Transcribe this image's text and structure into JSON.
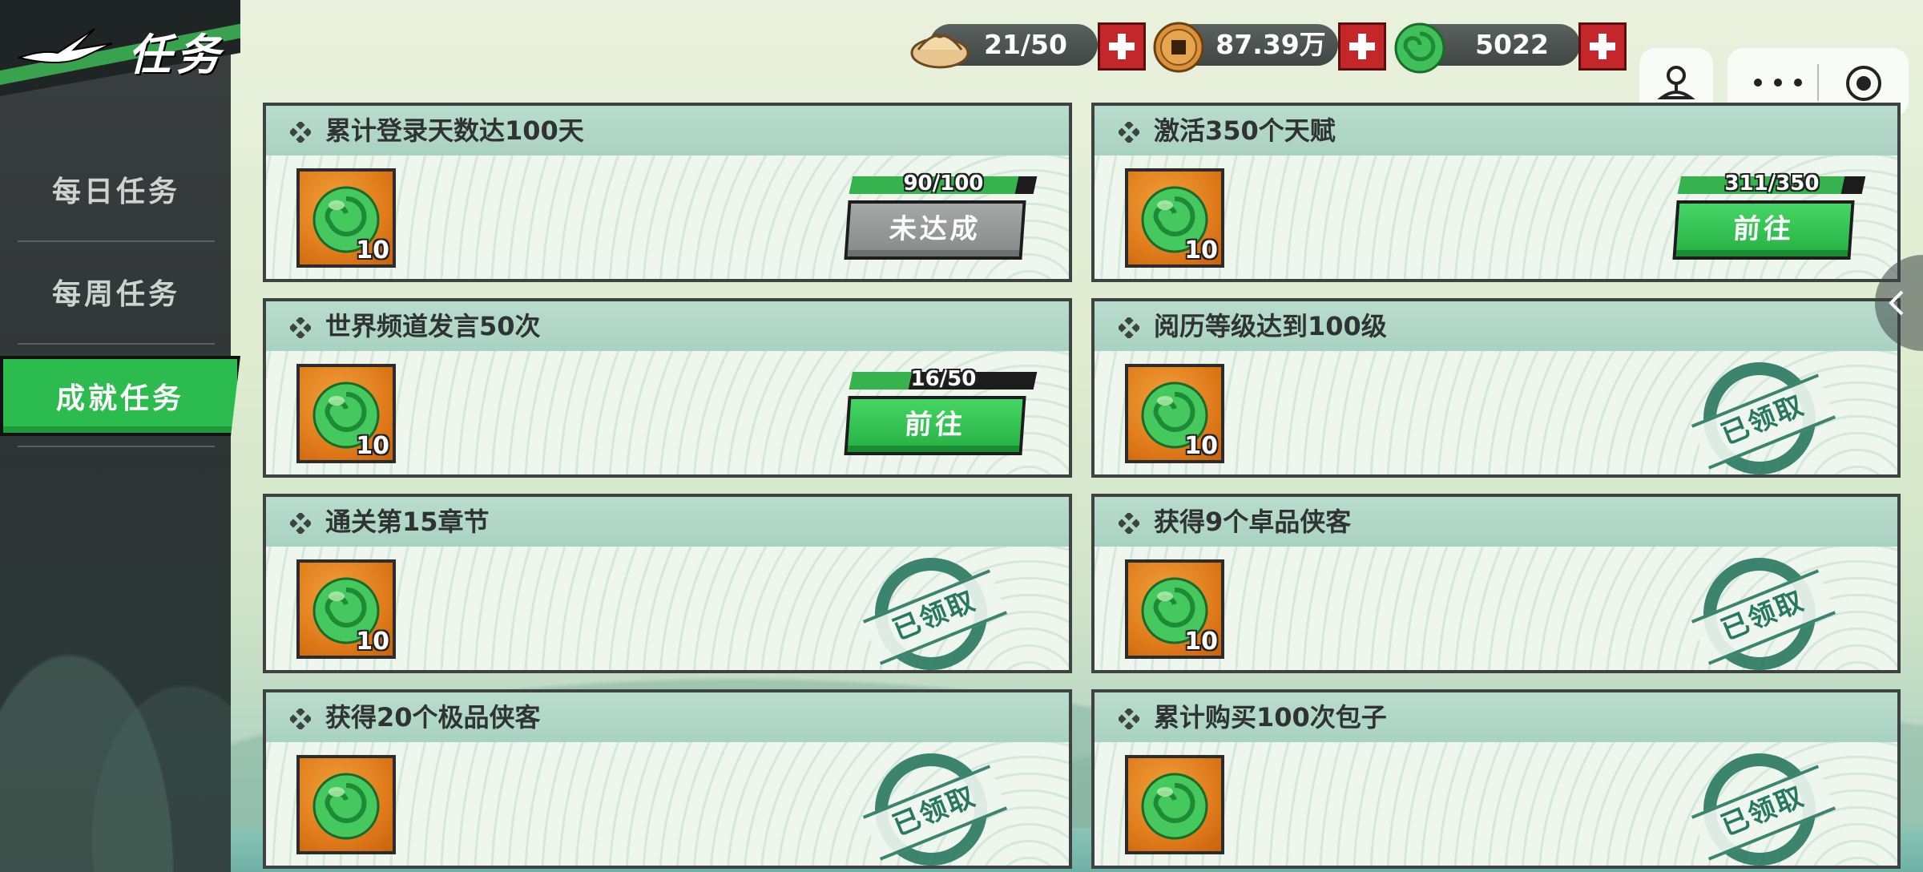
{
  "header": {
    "title": "任务"
  },
  "sidebar": {
    "items": [
      {
        "label": "每日任务",
        "active": false
      },
      {
        "label": "每周任务",
        "active": false
      },
      {
        "label": "成就任务",
        "active": true
      }
    ]
  },
  "resources": {
    "stamina": {
      "icon": "steamed-bun-icon",
      "value": "21/50"
    },
    "coins": {
      "icon": "copper-coin-icon",
      "value": "87.39万"
    },
    "jade": {
      "icon": "jade-icon",
      "value": "5022"
    }
  },
  "tasks": [
    {
      "title": "累计登录天数达100天",
      "reward": "10",
      "progress": "90/100",
      "progress_fraction": 0.9,
      "action": "未达成",
      "state": "locked"
    },
    {
      "title": "激活350个天赋",
      "reward": "10",
      "progress": "311/350",
      "progress_fraction": 0.889,
      "action": "前往",
      "state": "go"
    },
    {
      "title": "世界频道发言50次",
      "reward": "10",
      "progress": "16/50",
      "progress_fraction": 0.32,
      "action": "前往",
      "state": "go"
    },
    {
      "title": "阅历等级达到100级",
      "reward": "10",
      "stamp": "已领取",
      "state": "claimed"
    },
    {
      "title": "通关第15章节",
      "reward": "10",
      "stamp": "已领取",
      "state": "claimed"
    },
    {
      "title": "获得9个卓品侠客",
      "reward": "10",
      "stamp": "已领取",
      "state": "claimed"
    },
    {
      "title": "获得20个极品侠客",
      "reward": "",
      "stamp": "已领取",
      "state": "claimed"
    },
    {
      "title": "累计购买100次包子",
      "reward": "",
      "stamp": "已领取",
      "state": "claimed"
    }
  ],
  "colors": {
    "accent_green": "#2cbb4e",
    "plus_red": "#c5262a",
    "stamp_green": "#287860"
  }
}
